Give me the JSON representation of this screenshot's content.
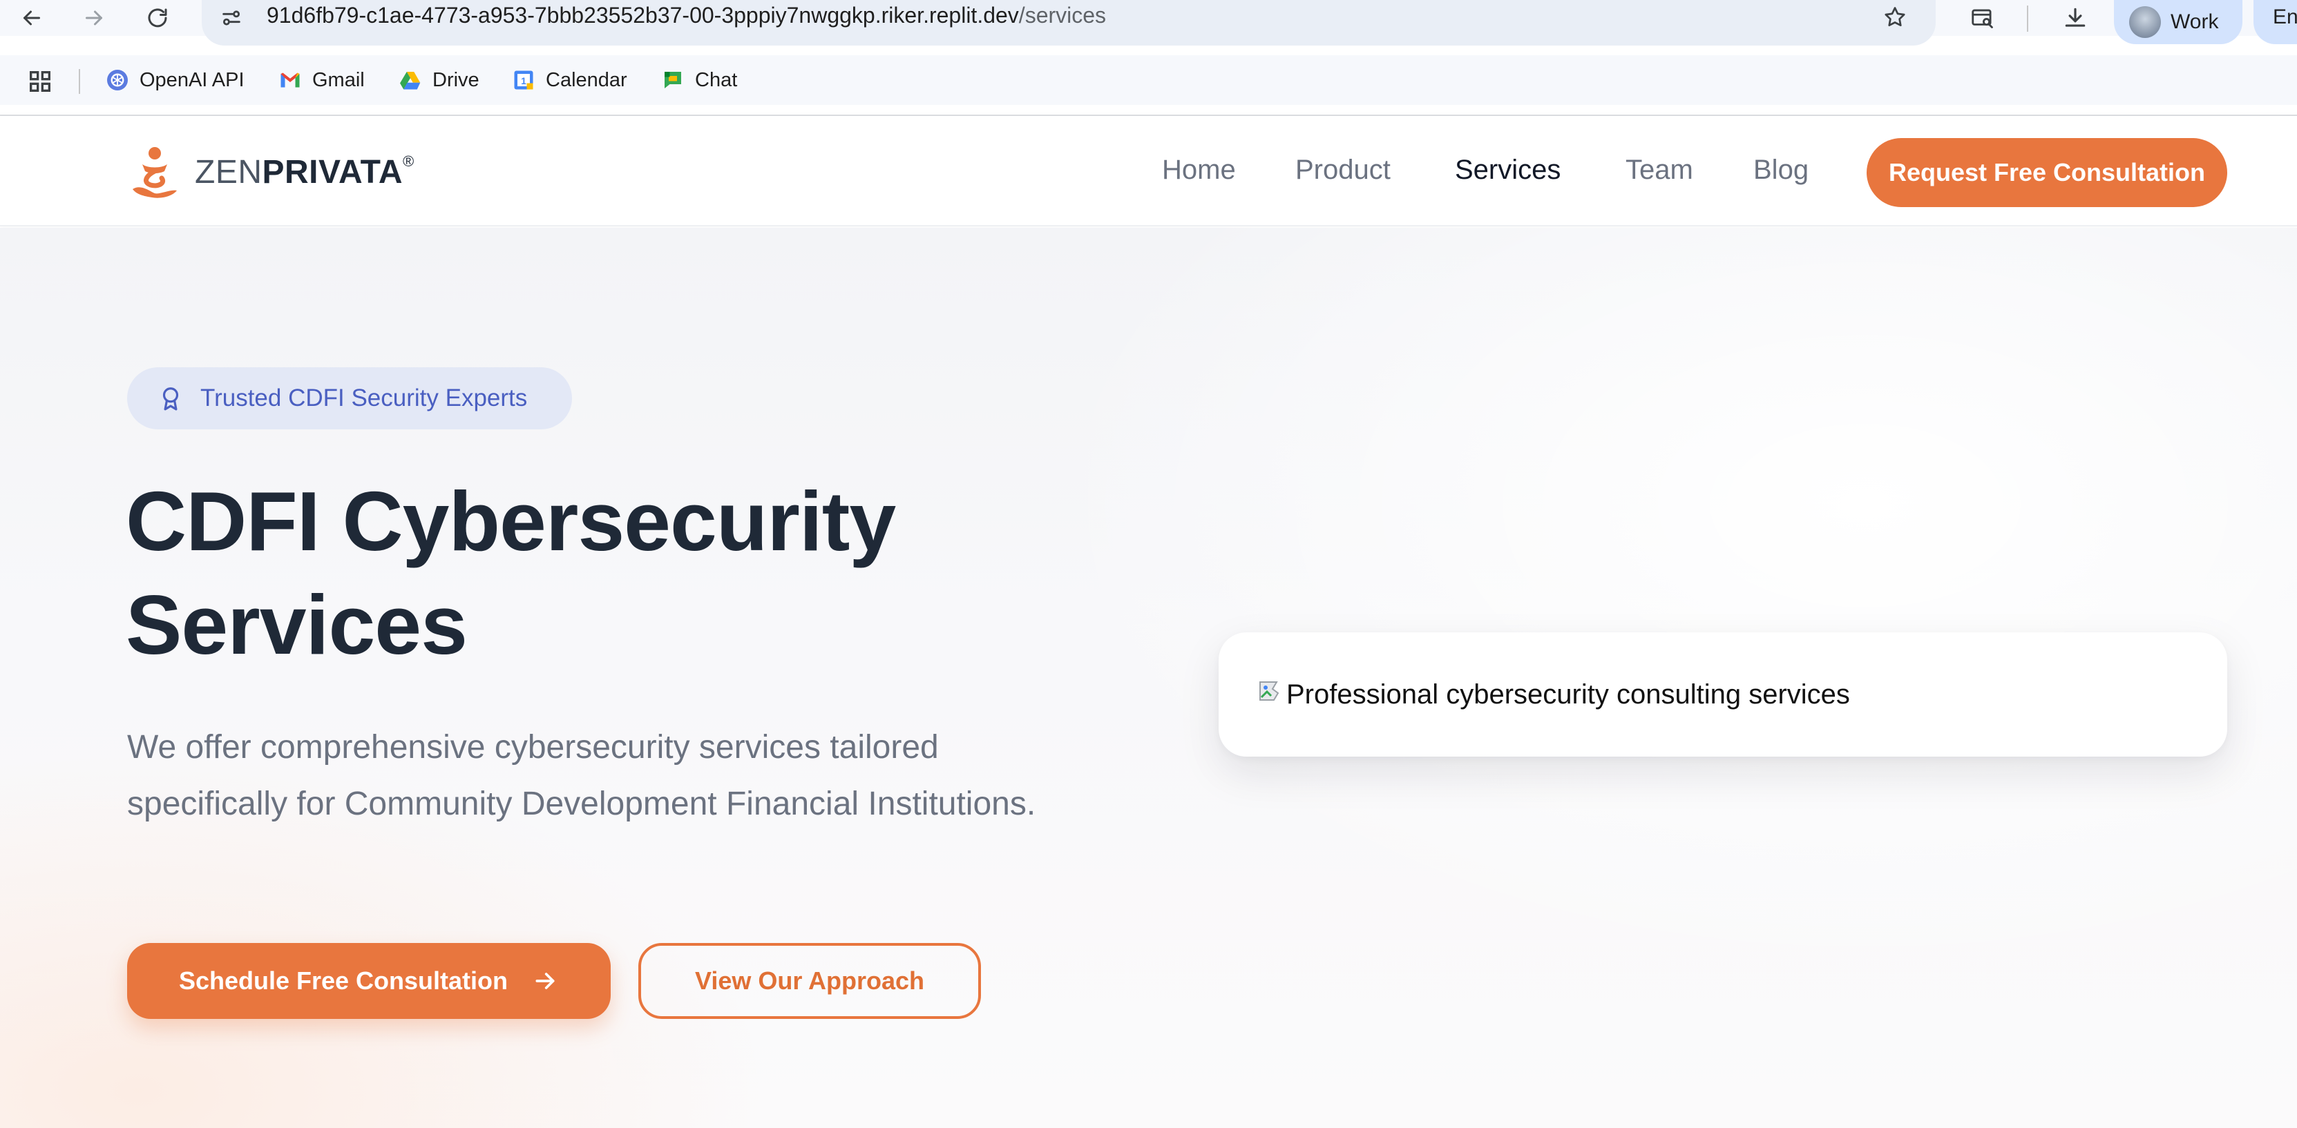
{
  "browser": {
    "url_host": "91d6fb79-c1ae-4773-a953-7bbb23552b37-00-3pppiy7nwggkp.riker.replit.dev",
    "url_path": "/services",
    "profile_label": "Work",
    "extension_label": "En",
    "bookmarks": [
      {
        "label": "OpenAI API",
        "icon": "openai-icon"
      },
      {
        "label": "Gmail",
        "icon": "gmail-icon"
      },
      {
        "label": "Drive",
        "icon": "drive-icon"
      },
      {
        "label": "Calendar",
        "icon": "calendar-icon"
      },
      {
        "label": "Chat",
        "icon": "chat-icon"
      }
    ]
  },
  "site": {
    "logo_light": "ZEN",
    "logo_bold": "PRIVATA",
    "logo_reg": "®",
    "nav": [
      {
        "label": "Home",
        "active": false
      },
      {
        "label": "Product",
        "active": false
      },
      {
        "label": "Services",
        "active": true
      },
      {
        "label": "Team",
        "active": false
      },
      {
        "label": "Blog",
        "active": false
      }
    ],
    "header_cta": "Request Free Consultation",
    "brand_color": "#e8763e"
  },
  "hero": {
    "badge": "Trusted CDFI Security Experts",
    "title_line1": "CDFI Cybersecurity",
    "title_line2": "Services",
    "subtitle": "We offer comprehensive cybersecurity services tailored specifically for Community Development Financial Institutions.",
    "primary_cta": "Schedule Free Consultation",
    "secondary_cta": "View Our Approach",
    "image_alt": "Professional cybersecurity consulting services"
  }
}
